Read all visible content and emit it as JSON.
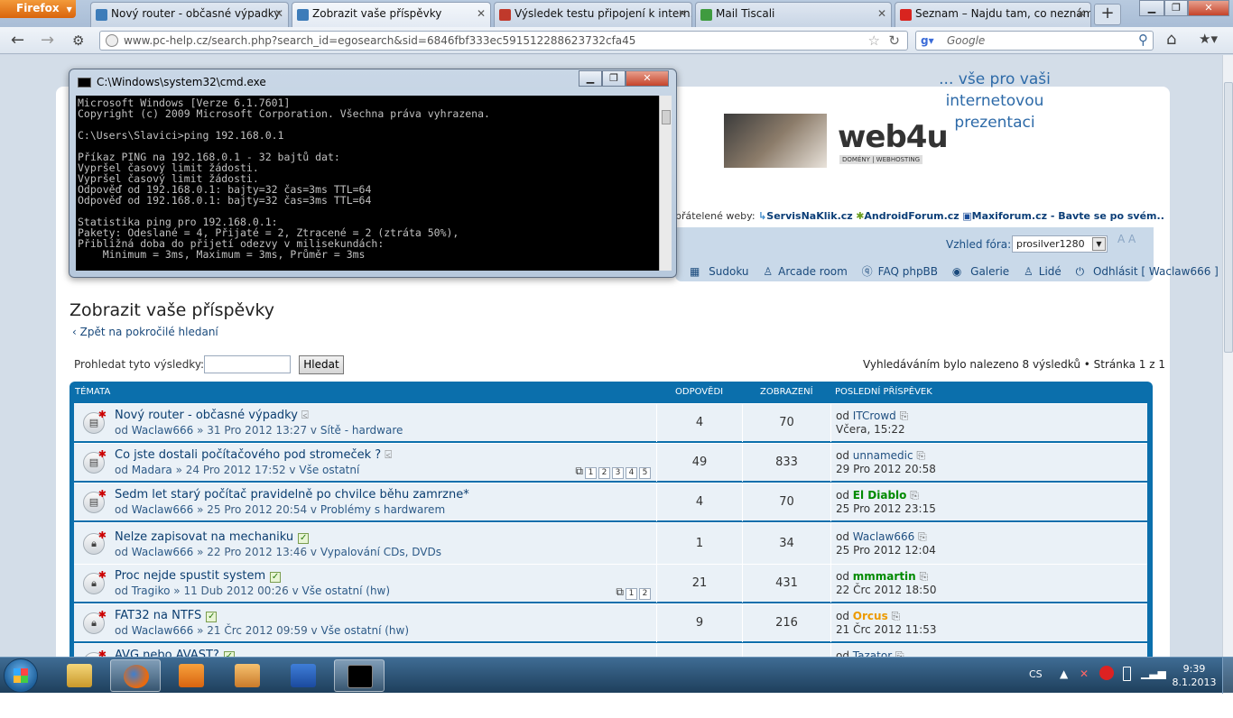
{
  "browser": {
    "menu_button": "Firefox",
    "tabs": [
      {
        "label": "Nový router - občasné výpadky",
        "fav": "#3d7cb9"
      },
      {
        "label": "Zobrazit vaše příspěvky",
        "fav": "#3d7cb9"
      },
      {
        "label": "Výsledek testu připojení k intern...",
        "fav": "#c0392b"
      },
      {
        "label": "Mail Tiscali",
        "fav": "#3f9b3f"
      },
      {
        "label": "Seznam – Najdu tam, co neznám",
        "fav": "#d8241f"
      }
    ],
    "new_tab": "+",
    "url": "www.pc-help.cz/search.php?search_id=egosearch&sid=6846fbf333ec591512288623732cfa45",
    "search_placeholder": "Google"
  },
  "cmd": {
    "title": "C:\\Windows\\system32\\cmd.exe",
    "lines": "Microsoft Windows [Verze 6.1.7601]\nCopyright (c) 2009 Microsoft Corporation. Všechna práva vyhrazena.\n\nC:\\Users\\Slavici>ping 192.168.0.1\n\nPříkaz PING na 192.168.0.1 - 32 bajtů dat:\nVypršel časový limit žádosti.\nVypršel časový limit žádosti.\nOdpověď od 192.168.0.1: bajty=32 čas=3ms TTL=64\nOdpověď od 192.168.0.1: bajty=32 čas=3ms TTL=64\n\nStatistika ping pro 192.168.0.1:\nPakety: Odeslané = 4, Přijaté = 2, Ztracené = 2 (ztráta 50%),\nPřibližná doba do přijetí odezvy v milisekundách:\n    Minimum = 3ms, Maximum = 3ms, Průměr = 3ms"
  },
  "site": {
    "banner_logo": "web4u",
    "banner_tag": "DOMÉNY | WEBHOSTING",
    "slogan_1": "... vše pro vaši",
    "slogan_2": "internetovou prezentaci",
    "friends_label": "přátelené weby:",
    "friends": [
      "ServisNaKlik.cz",
      "AndroidForum.cz",
      "Maxiforum.cz - Bavte se po svém.."
    ],
    "style_label": "Vzhled fóra:",
    "style_value": "prosilver1280",
    "font_size": "A A",
    "menu": [
      "Sudoku",
      "Arcade room",
      "FAQ phpBB",
      "Galerie",
      "Lidé",
      "Odhlásit [ Waclaw666 ]"
    ]
  },
  "main": {
    "heading": "Zobrazit vaše příspěvky",
    "back_link": "Zpět na pokročilé hledaní",
    "search_label": "Prohledat tyto výsledky:",
    "search_button": "Hledat",
    "results_text": "Vyhledáváním bylo nalezeno 8 výsledků • Stránka 1 z 1",
    "columns": {
      "topics": "TÉMATA",
      "replies": "ODPOVĚDI",
      "views": "ZOBRAZENÍ",
      "last": "POSLEDNÍ PŘÍSPĚVEK"
    },
    "rows": [
      {
        "title": "Nový router - občasné výpadky",
        "by": "od",
        "author": "Waclaw666",
        "date": "» 31 Pro 2012 13:27 v",
        "forum": "Sítě - hardware",
        "replies": "4",
        "views": "70",
        "last_by": "ITCrowd",
        "last_date": "Včera, 15:22"
      },
      {
        "title": "Co jste dostali počítačového pod stromeček ?",
        "by": "od",
        "author": "Madara",
        "date": "» 24 Pro 2012 17:52 v",
        "forum": "Vše ostatní",
        "replies": "49",
        "views": "833",
        "last_by": "unnamedic",
        "last_date": "29 Pro 2012 20:58",
        "pages": [
          "1",
          "2",
          "3",
          "4",
          "5"
        ]
      },
      {
        "title": "Sedm let starý počítač pravidelně po chvilce běhu zamrzne*",
        "by": "od",
        "author": "Waclaw666",
        "date": "» 25 Pro 2012 20:54 v",
        "forum": "Problémy s hardwarem",
        "replies": "4",
        "views": "70",
        "last_by": "El Diablo",
        "last_date": "25 Pro 2012 23:15"
      },
      {
        "title": "Nelze zapisovat na mechaniku",
        "by": "od",
        "author": "Waclaw666",
        "date": "» 22 Pro 2012 13:46 v",
        "forum": "Vypalování CDs, DVDs",
        "replies": "1",
        "views": "34",
        "last_by": "Waclaw666",
        "last_date": "25 Pro 2012 12:04"
      },
      {
        "title": "Proc nejde spustit system",
        "by": "od",
        "author": "Tragiko",
        "date": "» 11 Dub 2012 00:26 v",
        "forum": "Vše ostatní (hw)",
        "replies": "21",
        "views": "431",
        "last_by": "mmmartin",
        "last_date": "22 Črc 2012 18:50",
        "pages": [
          "1",
          "2"
        ]
      },
      {
        "title": "FAT32 na NTFS",
        "by": "od",
        "author": "Waclaw666",
        "date": "» 21 Črc 2012 09:59 v",
        "forum": "Vše ostatní (hw)",
        "replies": "9",
        "views": "216",
        "last_by": "Orcus",
        "last_date": "21 Črc 2012 11:53"
      },
      {
        "title": "AVG nebo AVAST?",
        "by": "od",
        "author": "",
        "date": "",
        "forum": "",
        "replies": "",
        "views": "",
        "last_by": "Tazator",
        "last_date": ""
      }
    ]
  },
  "taskbar": {
    "lang": "CS",
    "time": "9:39",
    "date": "8.1.2013"
  }
}
